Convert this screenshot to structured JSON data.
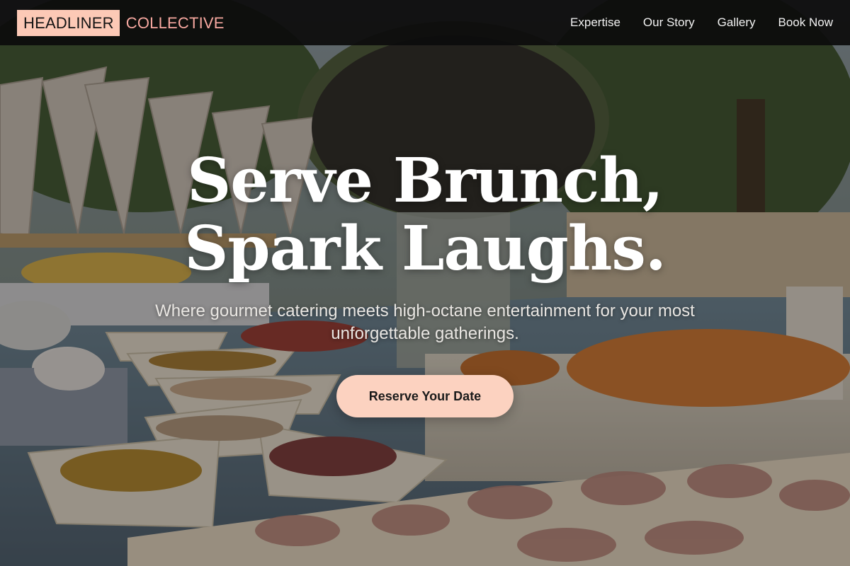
{
  "header": {
    "logo": {
      "primary": "HEADLINER",
      "secondary": "COLLECTIVE"
    },
    "nav": [
      {
        "label": "Expertise"
      },
      {
        "label": "Our Story"
      },
      {
        "label": "Gallery"
      },
      {
        "label": "Book Now"
      }
    ]
  },
  "hero": {
    "title_line_1": "Serve Brunch,",
    "title_line_2": "Spark Laughs.",
    "subtitle": "Where gourmet catering meets high-octane entertainment for your most unforgettable gatherings.",
    "cta_label": "Reserve Your Date",
    "background_image": "outdoor-catering-buffet-photo"
  },
  "colors": {
    "navbar_bg": "#0c0c0c",
    "logo_badge": "#fcc9b6",
    "logo_accent": "#f7a8a0",
    "cta_bg": "#fcd2c0",
    "cta_text": "#1a1a1a",
    "hero_text": "#ffffff"
  }
}
